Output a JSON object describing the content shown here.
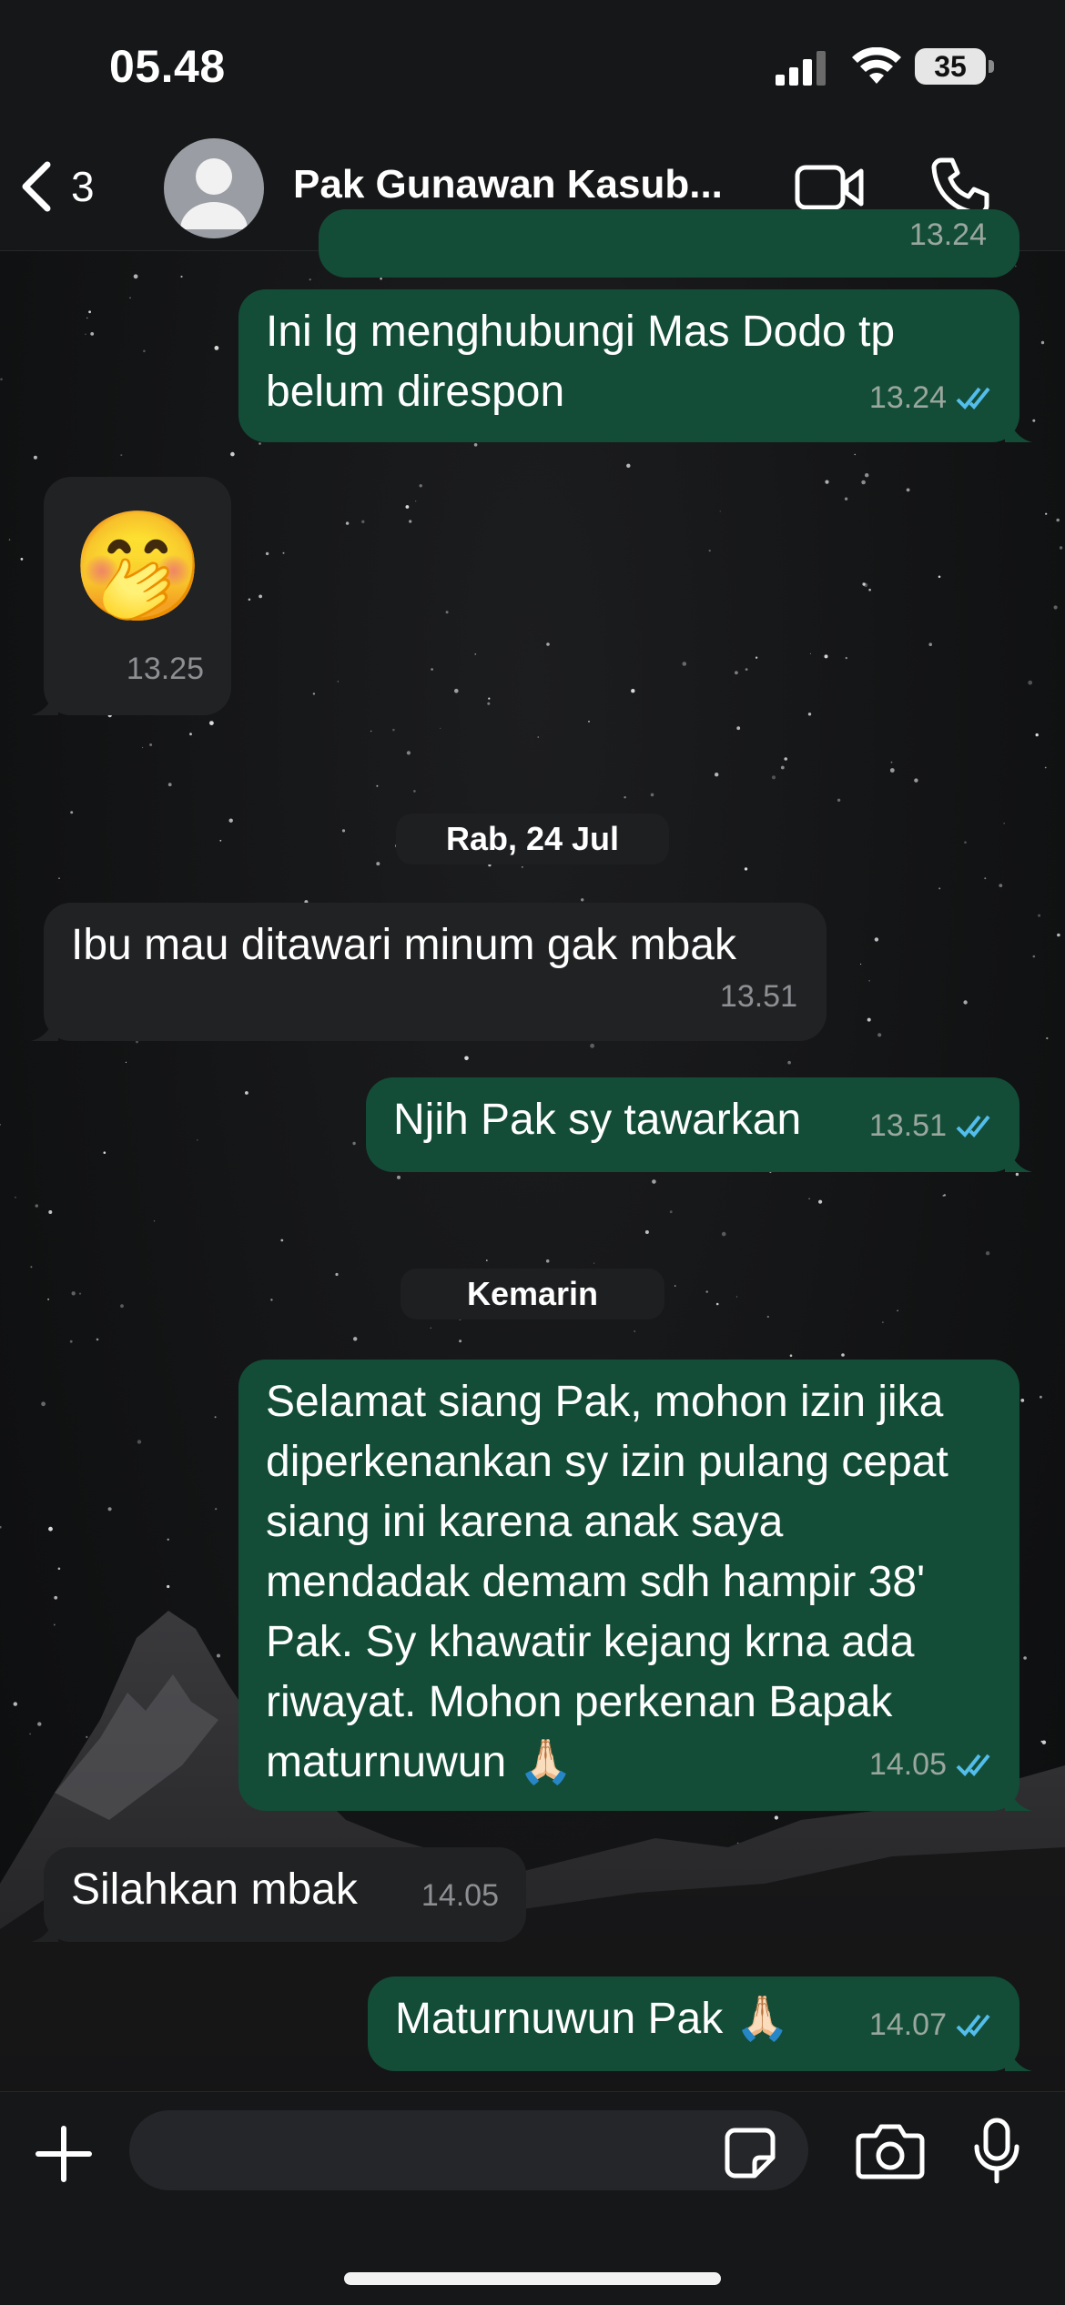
{
  "status_bar": {
    "time": "05.48",
    "battery": "35"
  },
  "header": {
    "back_count": "3",
    "contact_name": "Pak Gunawan Kasub..."
  },
  "messages": [
    {
      "text": "",
      "time": "13.24"
    },
    {
      "text": "Ini lg menghubungi Mas Dodo tp belum direspon",
      "time": "13.24"
    },
    {
      "text": "🤭",
      "time": "13.25"
    },
    {
      "text": "Ibu mau ditawari minum gak mbak",
      "time": "13.51"
    },
    {
      "text": "Njih Pak sy tawarkan",
      "time": "13.51"
    },
    {
      "text": "Selamat siang Pak, mohon izin jika diperkenankan sy izin pulang cepat siang ini karena anak saya mendadak demam sdh hampir 38' Pak. Sy khawatir kejang krna ada riwayat. Mohon perkenan Bapak maturnuwun 🙏🏻",
      "time": "14.05"
    },
    {
      "text": "Silahkan mbak",
      "time": "14.05"
    },
    {
      "text": "Maturnuwun Pak 🙏🏻",
      "time": "14.07"
    }
  ],
  "date_separators": [
    "Rab, 24 Jul",
    "Kemarin"
  ],
  "composer": {
    "placeholder": ""
  },
  "colors": {
    "outgoing_bubble": "#134d37",
    "incoming_bubble": "#212224",
    "read_ticks": "#53bdeb"
  }
}
